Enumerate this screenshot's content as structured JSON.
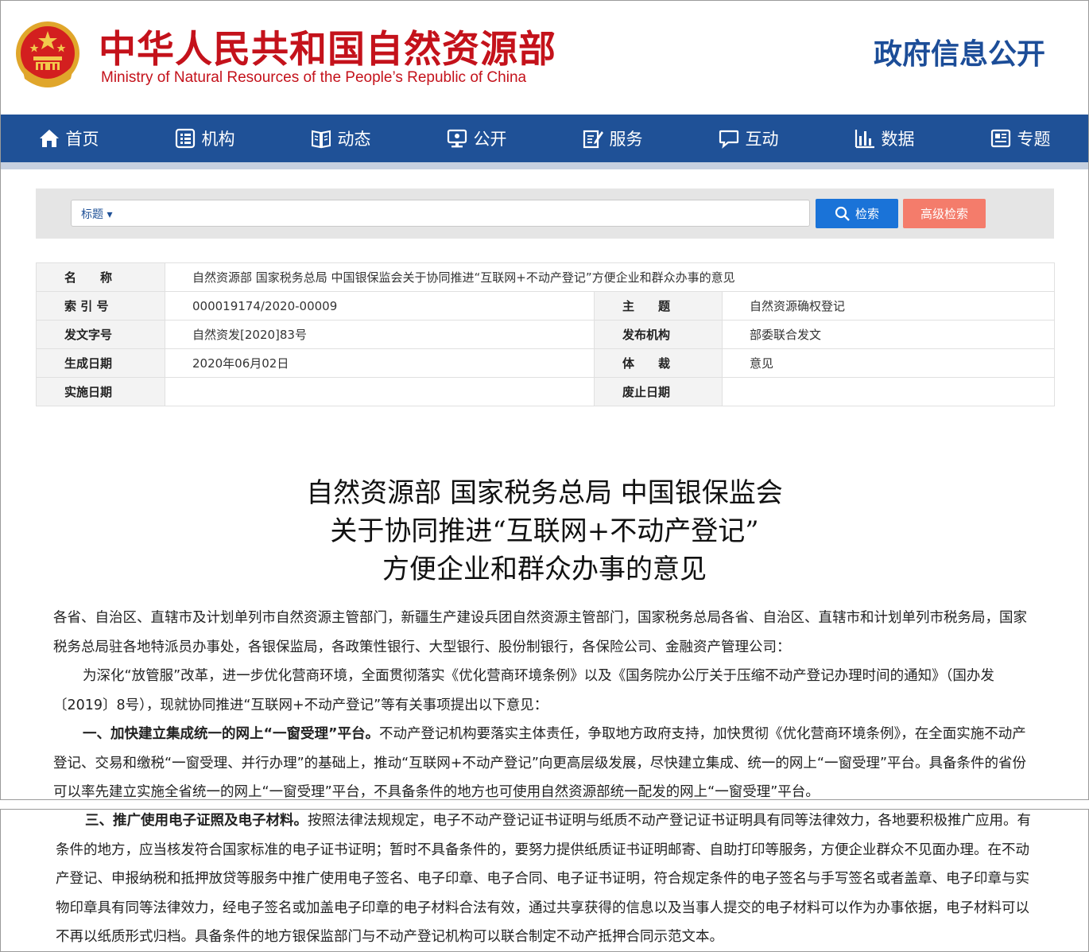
{
  "header": {
    "title_cn": "中华人民共和国自然资源部",
    "title_en": "Ministry of Natural Resources of the People’s Republic of China",
    "section": "政府信息公开",
    "colors": {
      "brand_red": "#c4121b",
      "brand_blue": "#1f5197"
    }
  },
  "nav": {
    "items": [
      {
        "label": "首页",
        "icon": "home-icon"
      },
      {
        "label": "机构",
        "icon": "org-icon"
      },
      {
        "label": "动态",
        "icon": "book-icon"
      },
      {
        "label": "公开",
        "icon": "monitor-icon"
      },
      {
        "label": "服务",
        "icon": "edit-icon"
      },
      {
        "label": "互动",
        "icon": "chat-icon"
      },
      {
        "label": "数据",
        "icon": "bar-chart-icon"
      },
      {
        "label": "专题",
        "icon": "newspaper-icon"
      }
    ]
  },
  "search": {
    "type_selected": "标题",
    "placeholder": "",
    "search_label": "检索",
    "advanced_label": "高级检索"
  },
  "meta": {
    "name_label": "名　　称",
    "name_value": "自然资源部 国家税务总局 中国银保监会关于协同推进“互联网+不动产登记”方便企业和群众办事的意见",
    "index_label": "索 引 号",
    "index_value": "000019174/2020-00009",
    "topic_label": "主　　题",
    "topic_value": "自然资源确权登记",
    "docno_label": "发文字号",
    "docno_value": "自然资发[2020]83号",
    "issuer_label": "发布机构",
    "issuer_value": "部委联合发文",
    "date_label": "生成日期",
    "date_value": "2020年06月02日",
    "genre_label": "体　　裁",
    "genre_value": "意见",
    "effective_label": "实施日期",
    "effective_value": "",
    "expire_label": "废止日期",
    "expire_value": ""
  },
  "doc": {
    "title_lines": [
      "自然资源部  国家税务总局  中国银保监会",
      "关于协同推进“互联网+不动产登记”",
      "方便企业和群众办事的意见"
    ],
    "address": "各省、自治区、直辖市及计划单列市自然资源主管部门，新疆生产建设兵团自然资源主管部门，国家税务总局各省、自治区、直辖市和计划单列市税务局，国家税务总局驻各地特派员办事处，各银保监局，各政策性银行、大型银行、股份制银行，各保险公司、金融资产管理公司：",
    "intro": "为深化“放管服”改革，进一步优化营商环境，全面贯彻落实《优化营商环境条例》以及《国务院办公厅关于压缩不动产登记办理时间的通知》（国办发〔2019〕8号），现就协同推进“互联网+不动产登记”等有关事项提出以下意见：",
    "section1_heading": "一、加快建立集成统一的网上“一窗受理”平台。",
    "section1_body": "不动产登记机构要落实主体责任，争取地方政府支持，加快贯彻《优化营商环境条例》，在全面实施不动产登记、交易和缴税“一窗受理、并行办理”的基础上，推动“互联网+不动产登记”向更高层级发展，尽快建立集成、统一的网上“一窗受理”平台。具备条件的省份可以率先建立实施全省统一的网上“一窗受理”平台，不具备条件的地方也可使用自然资源部统一配发的网上“一窗受理”平台。",
    "section3_heading": "三、推广使用电子证照及电子材料。",
    "section3_body": "按照法律法规规定，电子不动产登记证书证明与纸质不动产登记证书证明具有同等法律效力，各地要积极推广应用。有条件的地方，应当核发符合国家标准的电子证书证明；暂时不具备条件的，要努力提供纸质证书证明邮寄、自助打印等服务，方便企业群众不见面办理。在不动产登记、申报纳税和抵押放贷等服务中推广使用电子签名、电子印章、电子合同、电子证书证明，符合规定条件的电子签名与手写签名或者盖章、电子印章与实物印章具有同等法律效力，经电子签名或加盖电子印章的电子材料合法有效，通过共享获得的信息以及当事人提交的电子材料可以作为办事依据，电子材料可以不再以纸质形式归档。具备条件的地方银保监部门与不动产登记机构可以联合制定不动产抵押合同示范文本。"
  }
}
